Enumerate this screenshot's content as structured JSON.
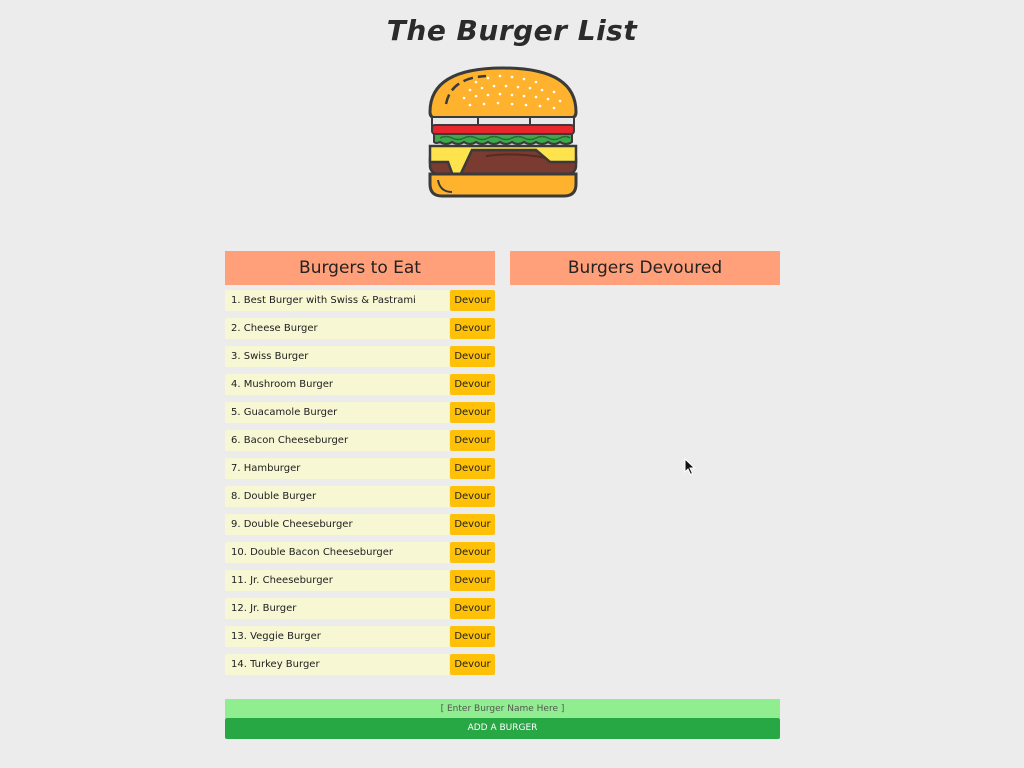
{
  "page": {
    "title": "The Burger List"
  },
  "panels": {
    "to_eat": {
      "title": "Burgers to Eat"
    },
    "devoured": {
      "title": "Burgers Devoured"
    }
  },
  "burgers": [
    {
      "name": "1. Best Burger with Swiss & Pastrami",
      "button": "Devour"
    },
    {
      "name": "2. Cheese Burger",
      "button": "Devour"
    },
    {
      "name": "3. Swiss Burger",
      "button": "Devour"
    },
    {
      "name": "4. Mushroom Burger",
      "button": "Devour"
    },
    {
      "name": "5. Guacamole Burger",
      "button": "Devour"
    },
    {
      "name": "6. Bacon Cheeseburger",
      "button": "Devour"
    },
    {
      "name": "7. Hamburger",
      "button": "Devour"
    },
    {
      "name": "8. Double Burger",
      "button": "Devour"
    },
    {
      "name": "9. Double Cheeseburger",
      "button": "Devour"
    },
    {
      "name": "10. Double Bacon Cheeseburger",
      "button": "Devour"
    },
    {
      "name": "11. Jr. Cheeseburger",
      "button": "Devour"
    },
    {
      "name": "12. Jr. Burger",
      "button": "Devour"
    },
    {
      "name": "13. Veggie Burger",
      "button": "Devour"
    },
    {
      "name": "14. Turkey Burger",
      "button": "Devour"
    }
  ],
  "form": {
    "input_value": "",
    "input_placeholder": "[ Enter Burger Name Here ]",
    "add_label": "ADD A BURGER"
  },
  "colors": {
    "background": "#ececec",
    "panel_header": "#ffa07a",
    "burger_name_bg": "#f7f7d4",
    "devour_button": "#ffc107",
    "input_bg": "#90ee90",
    "add_button": "#28a745"
  },
  "icons": {
    "logo": "burger-logo-icon",
    "cursor": "mouse-pointer-icon"
  }
}
